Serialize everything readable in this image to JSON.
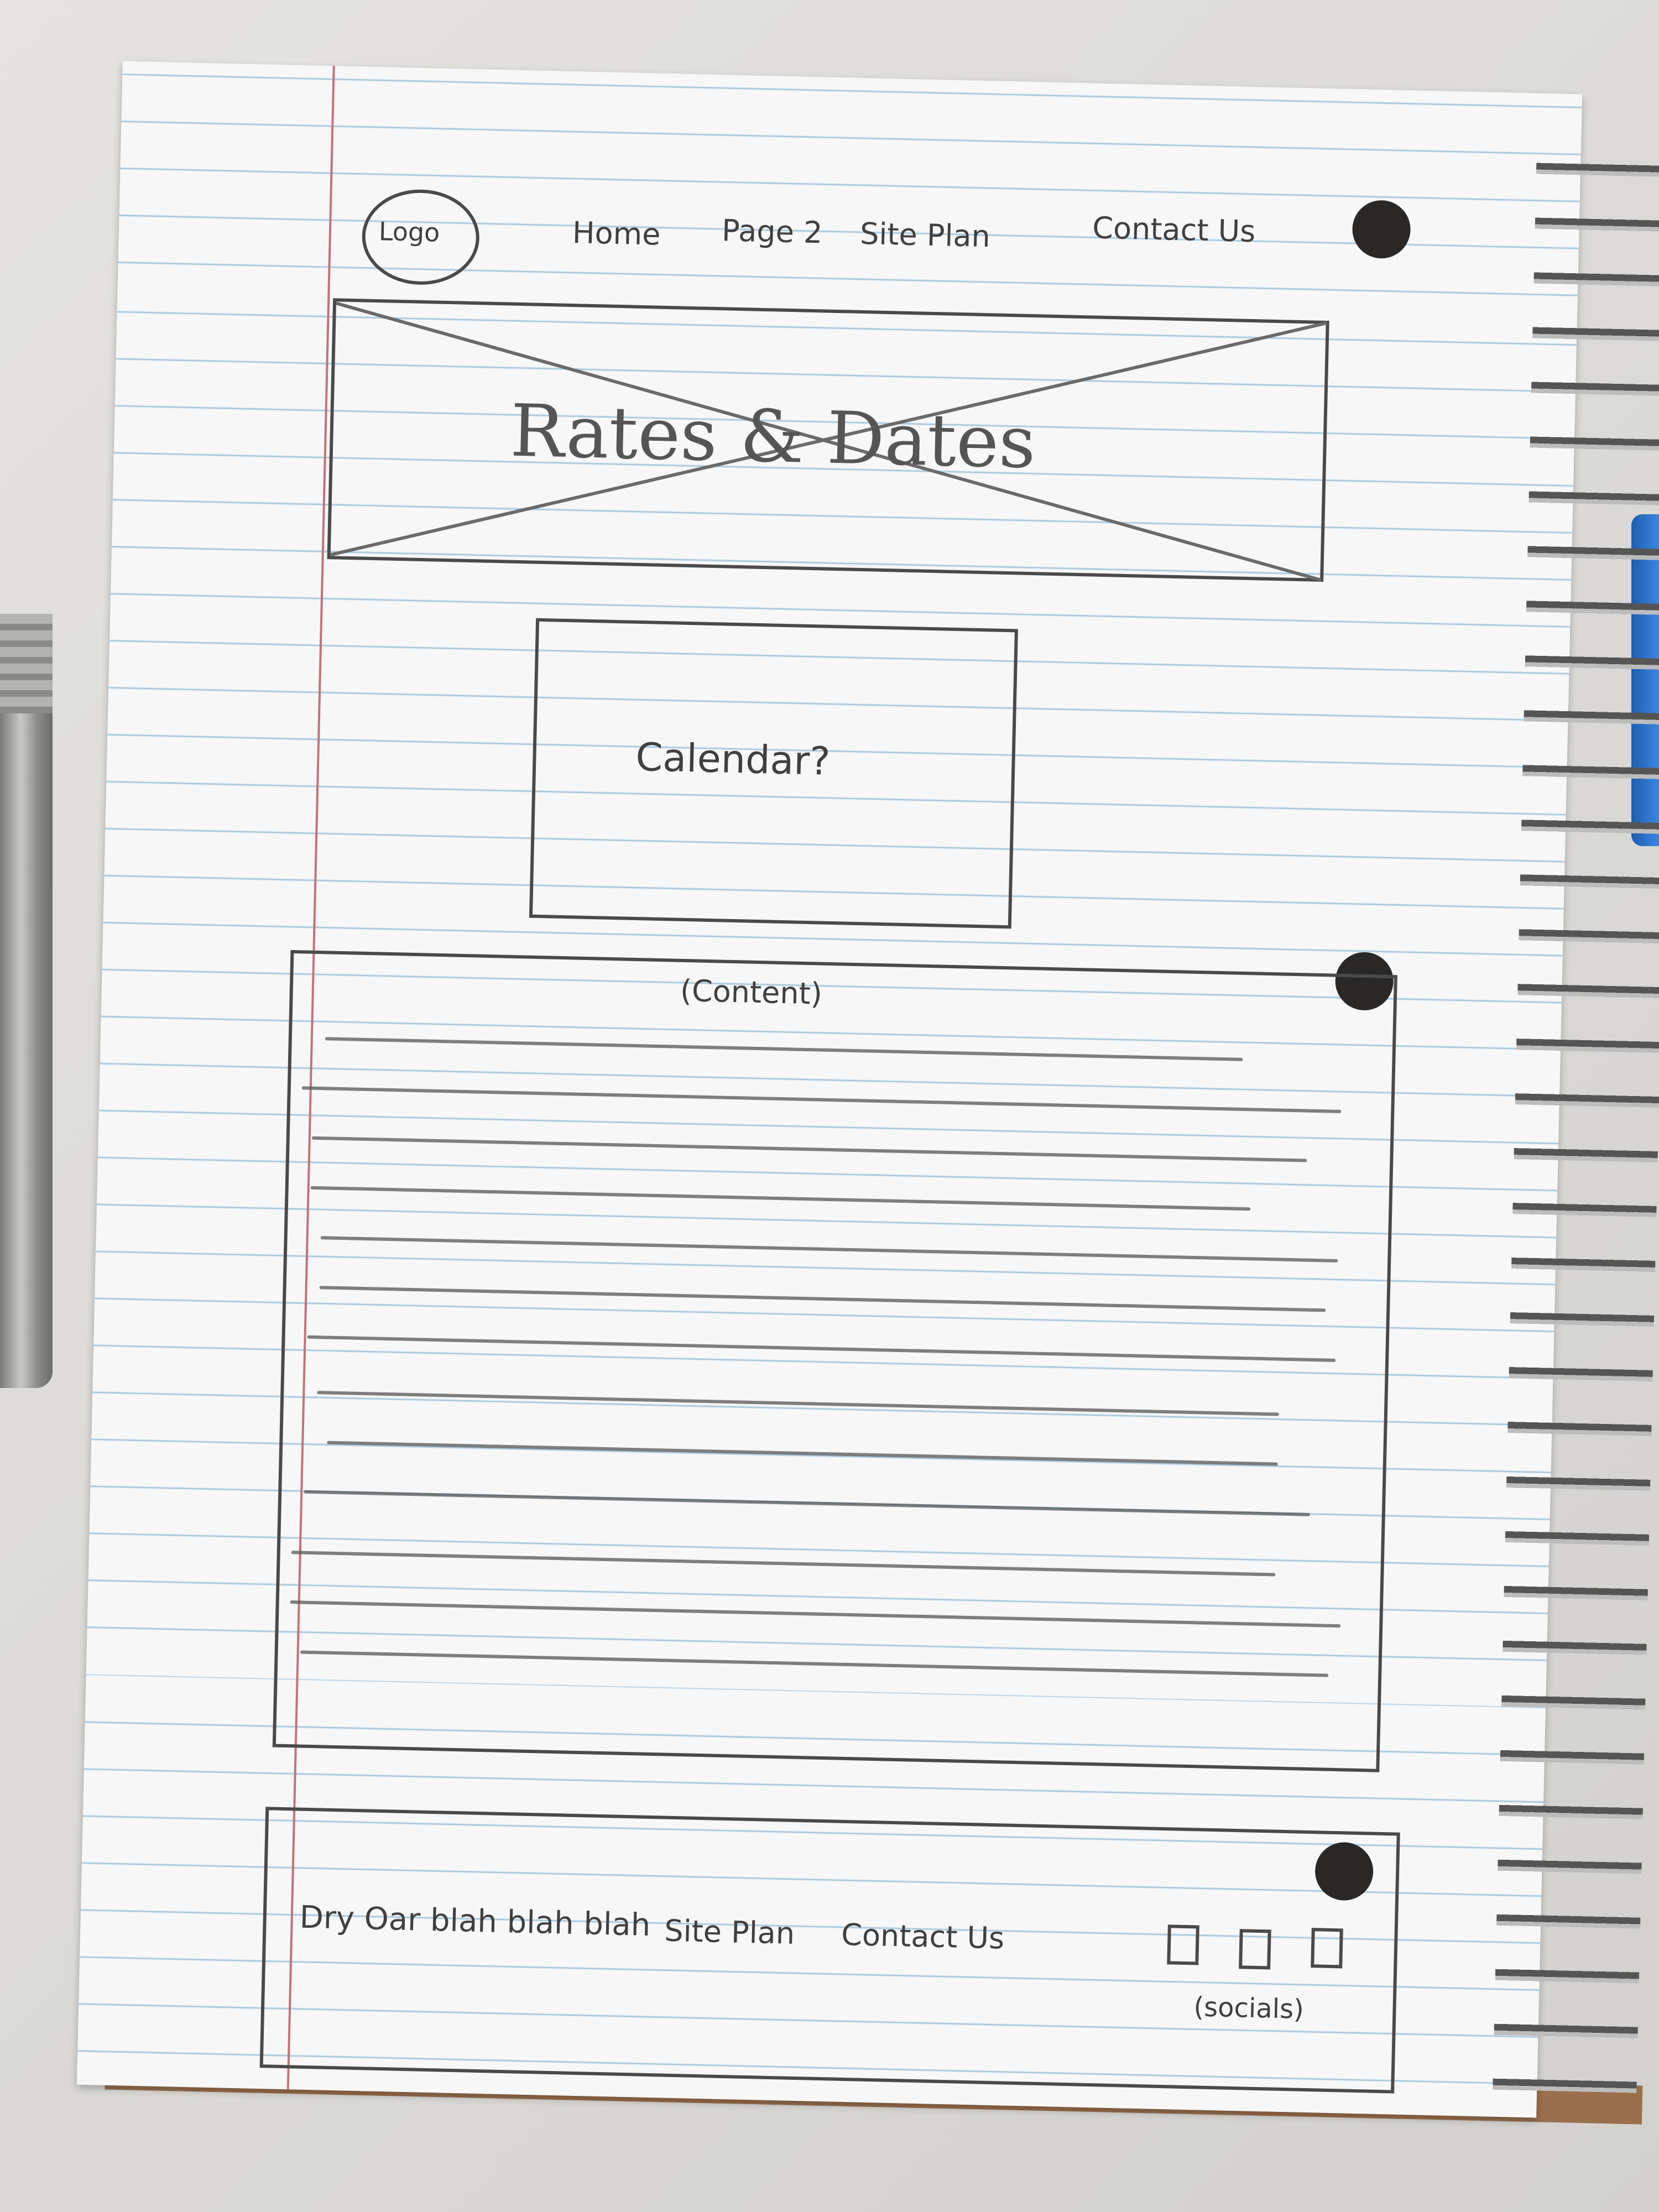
{
  "header": {
    "logo": "Logo",
    "nav": [
      "Home",
      "Page 2",
      "Site Plan",
      "Contact Us"
    ]
  },
  "hero": {
    "title": "Rates & Dates"
  },
  "calendar": {
    "label": "Calendar?"
  },
  "content": {
    "label": "(Content)"
  },
  "footer": {
    "tagline": "Dry Oar blah blah blah",
    "links": [
      "Site Plan",
      "Contact Us"
    ],
    "socials_label": "(socials)"
  }
}
